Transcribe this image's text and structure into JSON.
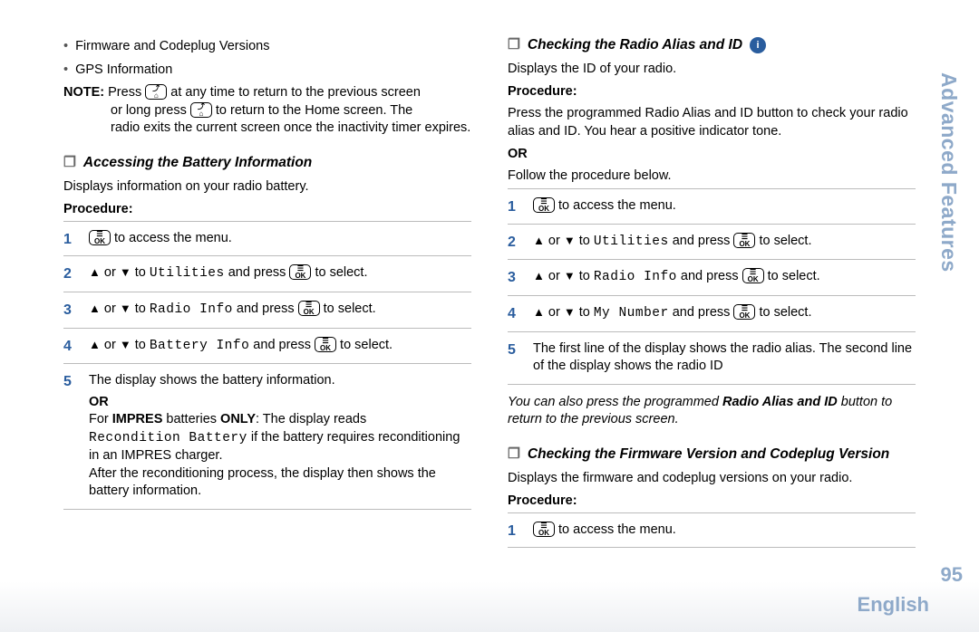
{
  "side_tab": "Advanced Features",
  "page_number": "95",
  "language": "English",
  "left": {
    "bullets": [
      "Firmware and Codeplug Versions",
      "GPS Information"
    ],
    "note_label": "NOTE:",
    "note_l1a": "Press ",
    "note_l1b": " at any time to return to the previous screen",
    "note_l2a": "or long press ",
    "note_l2b": " to return to the Home screen. The",
    "note_l3": "radio exits the current screen once the inactivity timer expires.",
    "sec1_title": "Accessing the Battery Information",
    "sec1_desc": "Displays information on your radio battery.",
    "proc_label": "Procedure:",
    "steps1": {
      "s1a": "",
      "s1b": " to access the menu.",
      "s2a": " or ",
      "s2b": " to ",
      "s2c": "Utilities",
      "s2d": " and press ",
      "s2e": " to select.",
      "s3c": "Radio Info",
      "s4c": "Battery Info",
      "s5": "The display shows the battery information.",
      "s5_or": "OR",
      "s5_b1a": "For ",
      "s5_b1b": "IMPRES",
      "s5_b1c": " batteries ",
      "s5_b1d": "ONLY",
      "s5_b1e": ": The display reads",
      "s5_b2a": "Recondition Battery",
      "s5_b2b": " if the battery requires reconditioning in an IMPRES charger.",
      "s5_b3": "After the reconditioning process, the display then shows the battery information."
    }
  },
  "right": {
    "sec2_title": "Checking the Radio Alias and ID",
    "sec2_desc": "Displays the ID of your radio.",
    "proc_label": "Procedure:",
    "sec2_p1": "Press the programmed Radio Alias and ID button to check your radio alias and ID. You hear a positive indicator tone.",
    "sec2_or": "OR",
    "sec2_p2": "Follow the procedure below.",
    "steps2": {
      "s1b": " to access the menu.",
      "s2c": "Utilities",
      "s3c": "Radio Info",
      "s4c": "My Number",
      "s5": "The first line of the display shows the radio alias. The second line of the display shows the radio ID"
    },
    "sec2_note_a": "You can also press the programmed ",
    "sec2_note_b": "Radio Alias and ID",
    "sec2_note_c": " button to return to the previous screen.",
    "sec3_title": "Checking the Firmware Version and Codeplug Version",
    "sec3_desc": "Displays the firmware and codeplug versions on your radio.",
    "steps3": {
      "s1b": " to access the menu."
    }
  },
  "keys": {
    "back_top": "⤴",
    "back_bot": "⌂",
    "ok_top": "☰",
    "ok_bot": "OK",
    "up": "▲",
    "down": "▼"
  }
}
